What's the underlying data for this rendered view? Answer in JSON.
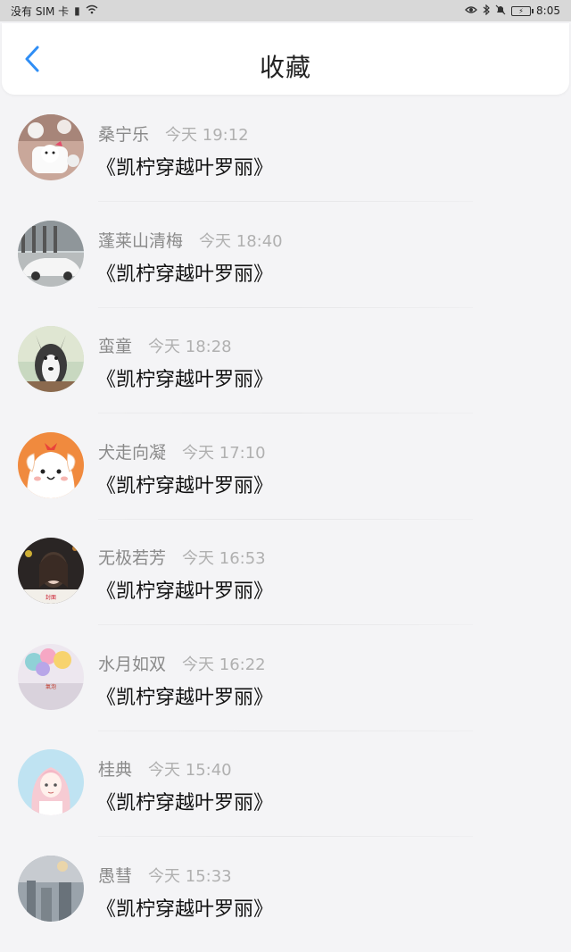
{
  "status_bar": {
    "carrier": "没有 SIM 卡",
    "time": "8:05",
    "icons": [
      "sim-icon",
      "wifi-icon",
      "eye-icon",
      "bluetooth-icon",
      "mute-icon",
      "battery-icon"
    ]
  },
  "header": {
    "title": "收藏",
    "back_icon": "chevron-left-icon"
  },
  "favorites": [
    {
      "name": "桑宁乐",
      "time": "今天 19:12",
      "title": "《凯柠穿越叶罗丽》"
    },
    {
      "name": "蓬莱山清梅",
      "time": "今天 18:40",
      "title": "《凯柠穿越叶罗丽》"
    },
    {
      "name": "蛮童",
      "time": "今天 18:28",
      "title": "《凯柠穿越叶罗丽》"
    },
    {
      "name": "犬走向凝",
      "time": "今天 17:10",
      "title": "《凯柠穿越叶罗丽》"
    },
    {
      "name": "无极若芳",
      "time": "今天 16:53",
      "title": "《凯柠穿越叶罗丽》"
    },
    {
      "name": "水月如双",
      "time": "今天 16:22",
      "title": "《凯柠穿越叶罗丽》"
    },
    {
      "name": "桂典",
      "time": "今天 15:40",
      "title": "《凯柠穿越叶罗丽》"
    },
    {
      "name": "愚彗",
      "time": "今天 15:33",
      "title": "《凯柠穿越叶罗丽》"
    }
  ],
  "colors": {
    "accent": "#2f8ef5",
    "background": "#f4f4f6",
    "name_gray": "#8a8a8a",
    "time_gray": "#b0b0b0"
  }
}
